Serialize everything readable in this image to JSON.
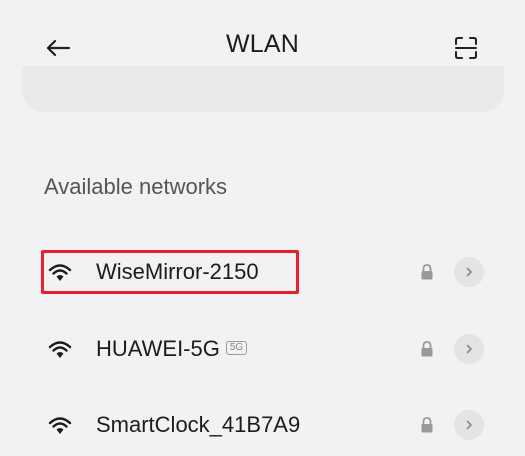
{
  "header": {
    "title": "WLAN",
    "back_icon": "arrow-left-icon",
    "scan_icon": "scan-icon"
  },
  "section": {
    "label": "Available networks"
  },
  "networks": [
    {
      "ssid": "WiseMirror-2150",
      "badge": "",
      "secured": true,
      "highlighted": true
    },
    {
      "ssid": "HUAWEI-5G",
      "badge": "5G",
      "secured": true,
      "highlighted": false
    },
    {
      "ssid": "SmartClock_41B7A9",
      "badge": "",
      "secured": true,
      "highlighted": false
    }
  ],
  "colors": {
    "highlight": "#e8202a",
    "background": "#f2f2f4"
  }
}
